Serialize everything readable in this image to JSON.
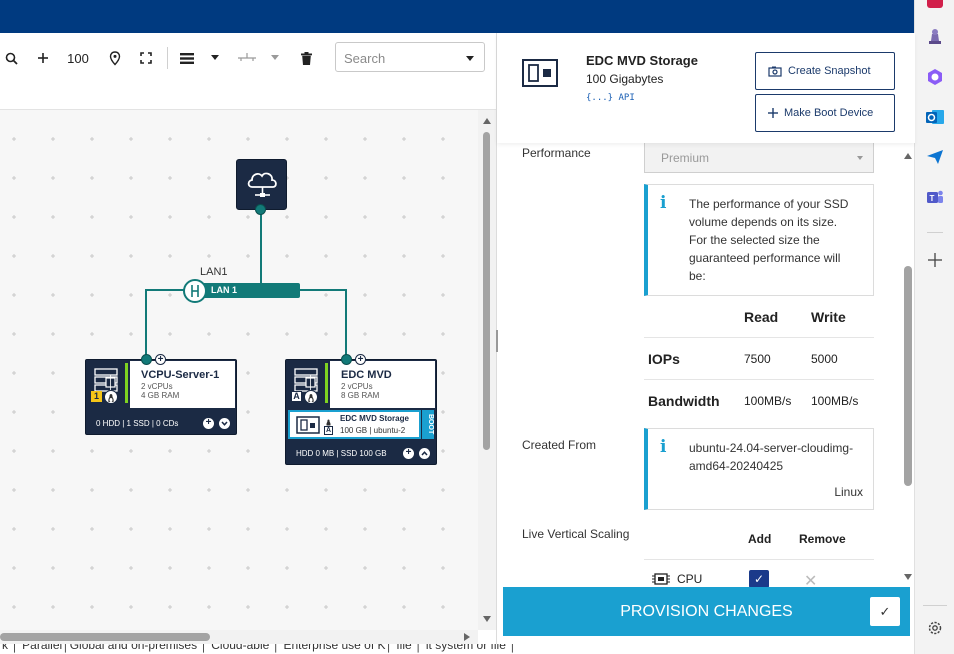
{
  "toolbar": {
    "zoom_value": "100",
    "search_placeholder": "Search"
  },
  "canvas": {
    "lan_label": "LAN1",
    "lan_bar_label": "LAN 1",
    "servers": [
      {
        "name": "VCPU-Server-1",
        "vcpus": "2 vCPUs",
        "ram": "4 GB RAM",
        "badge": "1",
        "footer": "0 HDD | 1 SSD | 0 CDs"
      },
      {
        "name": "EDC MVD",
        "vcpus": "2 vCPUs",
        "ram": "8 GB RAM",
        "badge": "A",
        "disk_name": "EDC MVD Storage",
        "disk_info": "100 GB | ubuntu-2",
        "disk_badge": "A",
        "boot_tag": "BOOT",
        "footer": "HDD 0 MB | SSD 100 GB"
      }
    ]
  },
  "panel": {
    "title": "EDC MVD Storage",
    "subtitle": "100 Gigabytes",
    "api_label": "{...} API",
    "create_snapshot": "Create Snapshot",
    "make_boot_device": "Make Boot Device",
    "performance_label": "Performance",
    "performance_value": "Premium",
    "performance_info": [
      "The performance of your SSD",
      "volume depends on its size.",
      "For the selected size the",
      "guaranteed performance will",
      "be:"
    ],
    "perf_table": {
      "col_read": "Read",
      "col_write": "Write",
      "rows": [
        {
          "label": "IOPs",
          "read": "7500",
          "write": "5000"
        },
        {
          "label": "Bandwidth",
          "read": "100MB/s",
          "write": "100MB/s"
        }
      ]
    },
    "created_from_label": "Created From",
    "created_from_lines": [
      "ubuntu-24.04-server-cloudimg-",
      "amd64-20240425"
    ],
    "created_from_os": "Linux",
    "live_scaling_label": "Live Vertical Scaling",
    "scaling_add": "Add",
    "scaling_remove": "Remove",
    "scaling_cpu": "CPU",
    "provision_label": "PROVISION CHANGES"
  },
  "bottom_text": "k │ Parallel│Global and on-premises │ Cloud-able │ Enterprise use of K│ file │ it system or file │",
  "colors": {
    "top_bar": "#003a80",
    "node_dark": "#1b2a44",
    "lan_teal": "#127a78",
    "accent_blue": "#1aa0d0",
    "checkbox_blue": "#1b3a8a"
  }
}
